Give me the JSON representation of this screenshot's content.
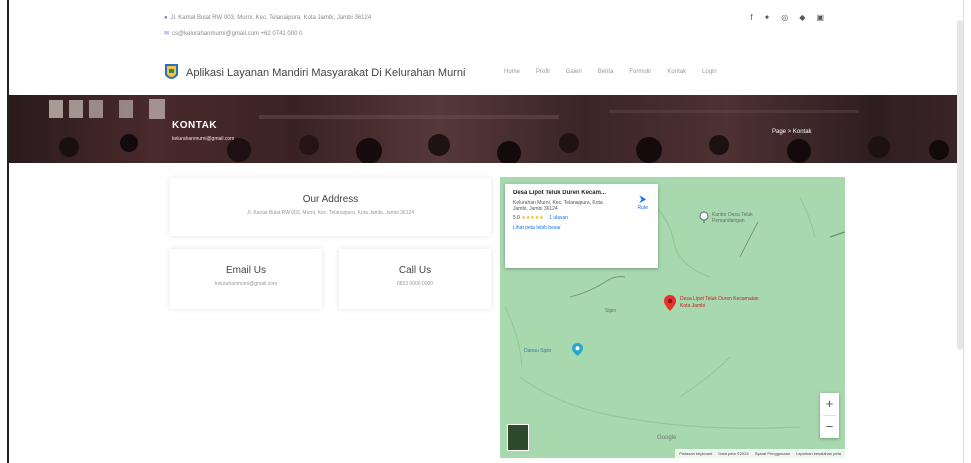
{
  "topbar": {
    "address": "Jl. Kamal Bulat RW 003, Murni, Kec. Telanaipura, Kota Jambi, Jambi 36124",
    "email_phone": "cs@kelurahanmurni@gmail.com +62 0741 000 0",
    "social": [
      "f",
      "t",
      "ig",
      "in",
      "yt"
    ]
  },
  "navbar": {
    "brand": "Aplikasi Layanan Mandiri Masyarakat Di Kelurahan Murni",
    "menu": [
      "Home",
      "Profil",
      "Galeri",
      "Berita",
      "Formulir",
      "Kontak",
      "Login"
    ]
  },
  "hero": {
    "title": "KONTAK",
    "subtitle": "kelurahanmurni@gmail.com",
    "breadcrumb": "Page > Kontak"
  },
  "cards": {
    "address_title": "Our Address",
    "address_text": "Jl. Kamal Bulat RW 003, Murni, Kec. Telanaipura, Kota Jambi, Jambi 36124",
    "email_title": "Email Us",
    "email_text": "kelurahanmurni@gmail.com",
    "call_title": "Call Us",
    "call_text": "0823 0000 0000"
  },
  "map": {
    "card_title": "Desa Lipot Teluk Duren Kecam...",
    "card_address": "Kelurahan Murni, Kec. Telanaipura, Kota Jambi, Jambi 36124",
    "rating": "5.0",
    "stars": "★★★★★",
    "reviews": "1 ulasan",
    "view_larger": "Lihat peta lebih besar",
    "directions": "Rute",
    "pin_label": "Desa Lipot Teluk Duren Kecamatan Kota Jambi",
    "poi_grey": "Kantor Desa Teluk Pemandangan",
    "poi_blue": "Danau Sipin",
    "road_label": "Sipin",
    "google": "Google",
    "zoom_in": "+",
    "zoom_out": "−",
    "attribution": [
      "Pintasan keyboard",
      "Data peta ©2024",
      "Syarat Penggunaan",
      "Laporkan kesalahan peta"
    ]
  },
  "colors": {
    "map_green": "#a7d8ae",
    "pin_red": "#e5312a",
    "link_blue": "#1a73e8"
  }
}
